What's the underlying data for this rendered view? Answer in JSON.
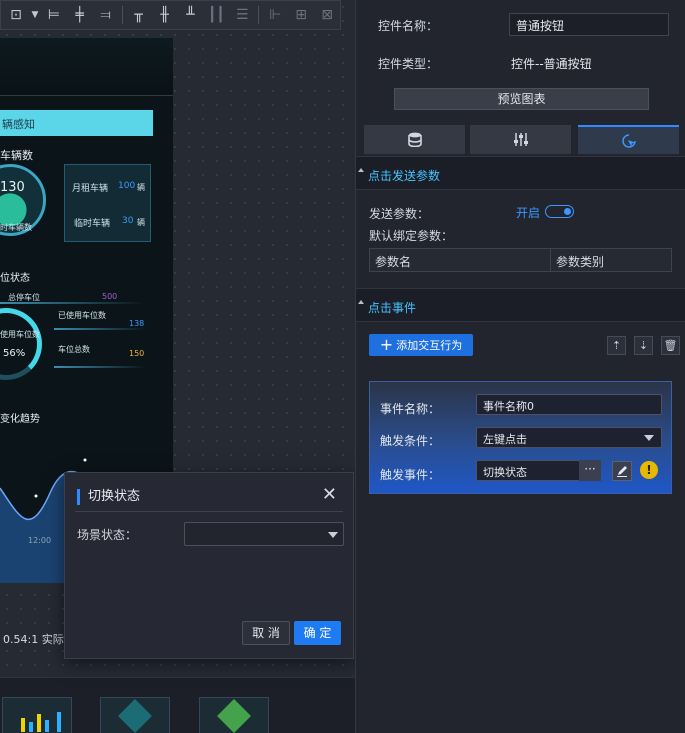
{
  "toolbar": {
    "icons": [
      "frame-select-icon",
      "align-left-icon",
      "align-center-icon",
      "align-right-icon",
      "align-top-icon",
      "align-middle-icon",
      "align-bottom-icon",
      "distribute-horizontal-icon",
      "distribute-vertical-icon",
      "group-icon",
      "ungroup-icon",
      "grid-icon"
    ]
  },
  "screen": {
    "header_text": "辆感知",
    "section1": "车辆数",
    "big_number": "130",
    "under_ring": "时车辆数",
    "monthly_label": "月租车辆",
    "monthly_value": "100",
    "monthly_unit": "辆",
    "temp_label": "临时车辆",
    "temp_value": "30",
    "temp_unit": "辆",
    "section2": "位状态",
    "total_stop_label": "总停车位",
    "total_stop_value": "500",
    "used_label": "已使用车位数",
    "used_value": "138",
    "ring_label": "使用车位数",
    "ring_percent": "56%",
    "spots_label": "车位总数",
    "spots_value": "150",
    "section3": "变化趋势",
    "axis_tick": "12:00"
  },
  "zoom": {
    "text": "0.54:1  实际."
  },
  "dialog": {
    "title": "切换状态",
    "scene_label": "场景状态：",
    "scene_value": "",
    "cancel": "取 消",
    "ok": "确 定"
  },
  "panel": {
    "name_label": "控件名称：",
    "name_value": "普通按钮",
    "type_label": "控件类型：",
    "type_value": "控件--普通按钮",
    "preview_button": "预览图表",
    "tabs": [
      "database-icon",
      "sliders-icon",
      "interaction-icon"
    ],
    "send_section": "点击发送参数",
    "send_label": "发送参数：",
    "send_toggle_text": "开启",
    "default_bind_label": "默认绑定参数：",
    "table_headers": [
      "参数名",
      "参数类别"
    ],
    "click_section": "点击事件",
    "add_button": "添加交互行为",
    "event": {
      "name_label": "事件名称：",
      "name_value": "事件名称0",
      "trigger_label": "触发条件：",
      "trigger_value": "左键点击",
      "action_label": "触发事件：",
      "action_value": "切换状态",
      "dots": "···",
      "warning": "!"
    }
  },
  "colors": {
    "accent": "#1e7bf2",
    "section_title": "#45c3ff",
    "warning": "#e6b800"
  }
}
